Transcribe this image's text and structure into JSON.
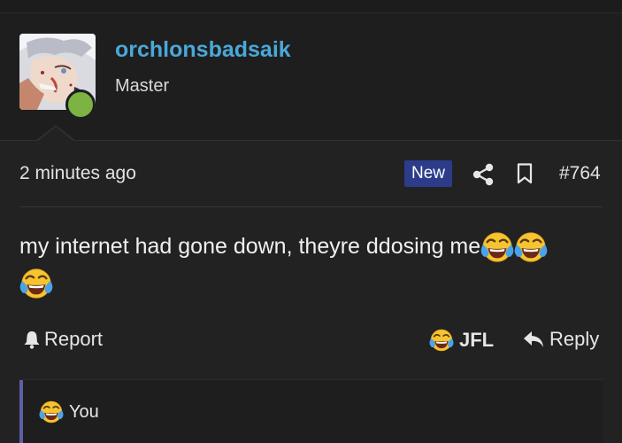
{
  "user": {
    "username": "orchlonsbadsaik",
    "title": "Master",
    "online": true
  },
  "post": {
    "time": "2 minutes ago",
    "badge": "New",
    "number": "#764",
    "message": "my internet had gone down, theyre ddosing me"
  },
  "actions": {
    "report": "Report",
    "reaction": "JFL",
    "reply": "Reply"
  },
  "reactions": {
    "summary": "You"
  },
  "icons": {
    "share": "share-icon",
    "bookmark": "bookmark-icon",
    "bell": "bell-icon",
    "reply": "reply-arrow-icon",
    "emoji": "face-with-tears-of-joy"
  },
  "colors": {
    "background": "#222222",
    "username": "#4aa8d8",
    "badge": "#2c3c8a",
    "online": "#7cb342",
    "accent": "#5d5fa8"
  }
}
